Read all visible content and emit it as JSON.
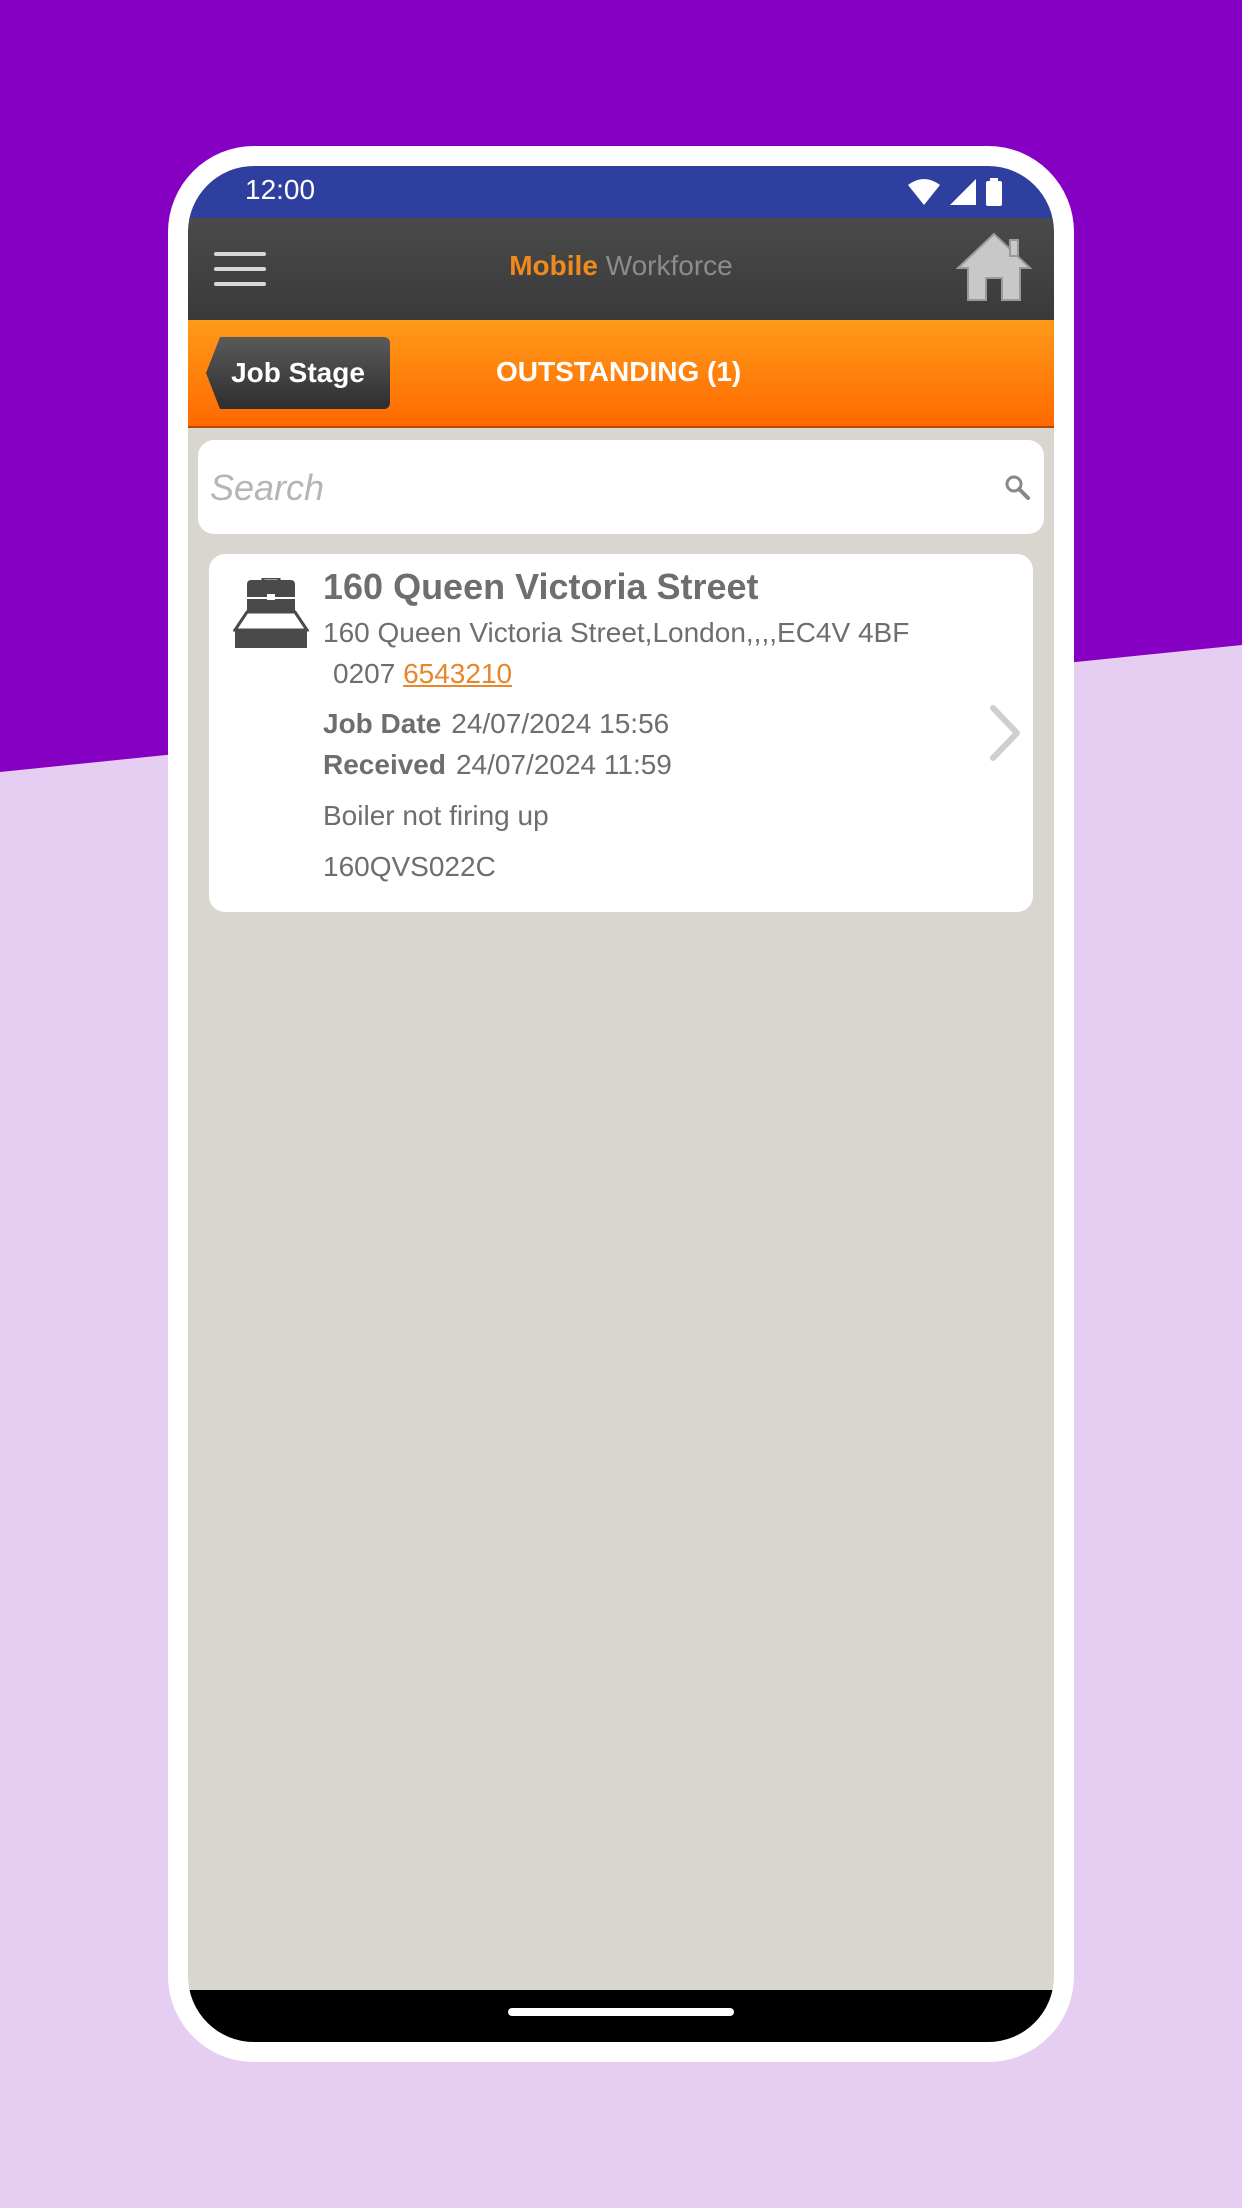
{
  "status_bar": {
    "time": "12:00"
  },
  "header": {
    "title_part1": "Mobile",
    "title_part2": "Workforce"
  },
  "stage_bar": {
    "back_label": "Job Stage",
    "title": "OUTSTANDING (1)"
  },
  "search": {
    "placeholder": "Search"
  },
  "job": {
    "title": "160 Queen Victoria Street",
    "address": "160 Queen Victoria Street,London,,,,EC4V 4BF",
    "phone_prefix": "0207",
    "phone_number": "6543210",
    "job_date_label": "Job Date",
    "job_date_value": "24/07/2024 15:56",
    "received_label": "Received",
    "received_value": "24/07/2024 11:59",
    "description": "Boiler not firing up",
    "reference": "160QVS022C"
  },
  "colors": {
    "accent_orange": "#ff7f0e",
    "status_bar": "#2f3f9f",
    "background_purple": "#8500c2",
    "background_lilac": "#e6cdf2"
  }
}
